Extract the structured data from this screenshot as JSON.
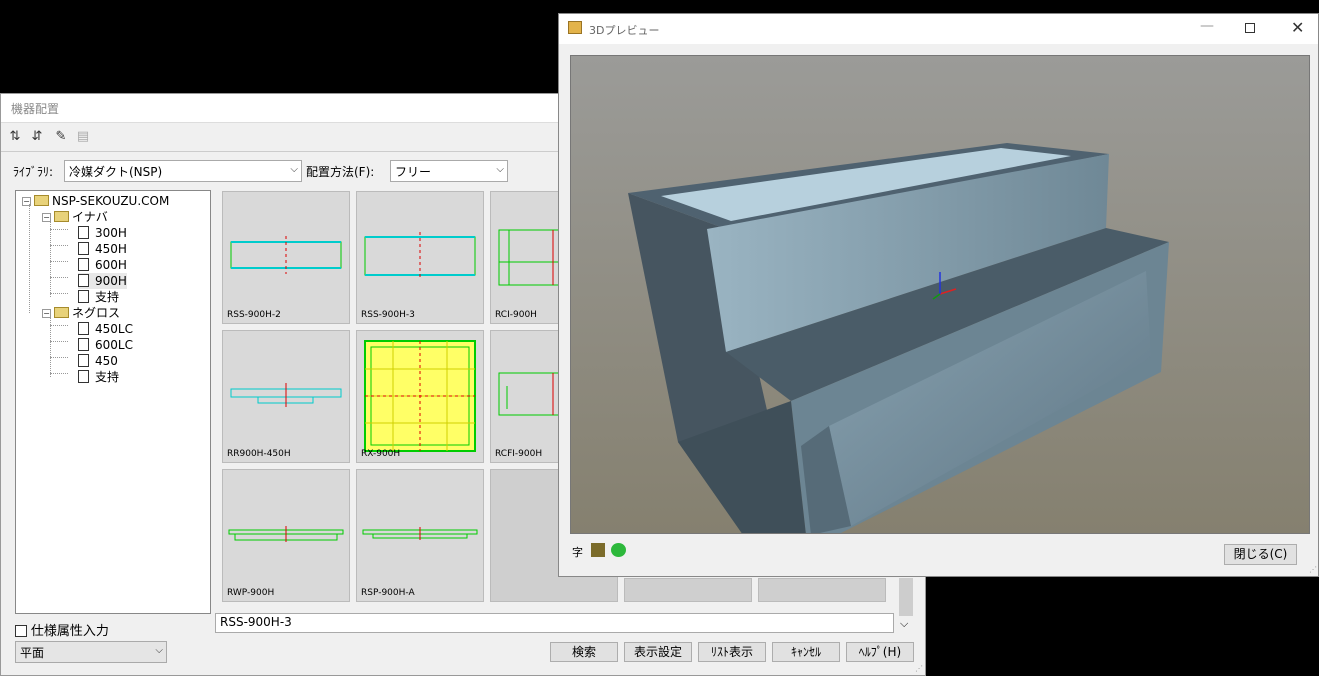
{
  "main": {
    "title": "機器配置",
    "library_label": "ﾗｲﾌﾞﾗﾘ:",
    "library_value": "冷媒ダクト(NSP)",
    "placement_label": "配置方法(F):",
    "placement_value": "フリー",
    "tree": {
      "root": "NSP-SEKOUZU.COM",
      "groups": [
        {
          "label": "イナバ",
          "items": [
            "300H",
            "450H",
            "600H",
            "900H",
            "支持"
          ]
        },
        {
          "label": "ネグロス",
          "items": [
            "450LC",
            "600LC",
            "450",
            "支持"
          ]
        }
      ]
    },
    "tiles": [
      "RSS-900H-2",
      "RSS-900H-3",
      "RCI-900H",
      "RR900H-450H",
      "RX-900H",
      "RCFI-900H",
      "RWP-900H",
      "RSP-900H-A"
    ],
    "spec_checkbox_label": "仕様属性入力",
    "selected_name": "RSS-900H-3",
    "view_value": "平面",
    "buttons": {
      "search": "検索",
      "display": "表示設定",
      "list": "ﾘｽﾄ表示",
      "cancel": "ｷｬﾝｾﾙ",
      "help": "ﾍﾙﾌﾟ(H)"
    }
  },
  "preview": {
    "title": "3Dプレビュー",
    "close_button": "閉じる(C)",
    "char_icon": "字"
  },
  "colors": {
    "background": "#000000",
    "dialog": "#f0f0f0",
    "tile": "#d9d9d9",
    "duct": "#7f99a6"
  }
}
